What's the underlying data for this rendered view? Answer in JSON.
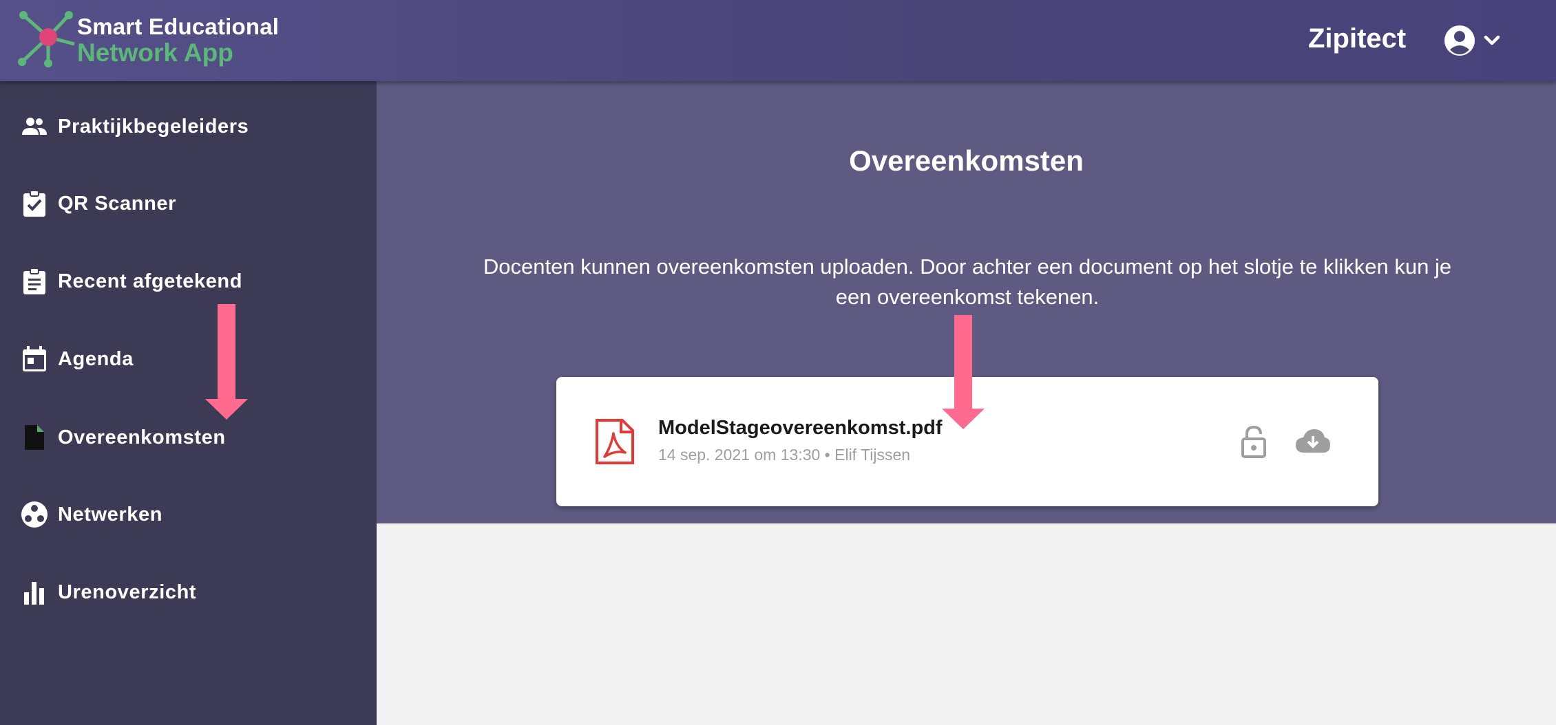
{
  "header": {
    "brand_line1": "Smart Educational",
    "brand_line2": "Network App",
    "org_name": "Zipitect",
    "account_icon": "account-circle-icon",
    "dropdown_icon": "chevron-down-icon"
  },
  "sidebar": {
    "items": [
      {
        "label": "Praktijkbegeleiders",
        "icon": "people-icon",
        "active": false
      },
      {
        "label": "QR Scanner",
        "icon": "clipboard-check-icon",
        "active": false
      },
      {
        "label": "Recent afgetekend",
        "icon": "clipboard-list-icon",
        "active": false
      },
      {
        "label": "Agenda",
        "icon": "calendar-icon",
        "active": false
      },
      {
        "label": "Overeenkomsten",
        "icon": "document-icon",
        "active": true
      },
      {
        "label": "Netwerken",
        "icon": "network-icon",
        "active": false
      },
      {
        "label": "Urenoverzicht",
        "icon": "bar-chart-icon",
        "active": false
      }
    ]
  },
  "main": {
    "title": "Overeenkomsten",
    "intro": "Docenten kunnen overeenkomsten uploaden. Door achter een document op het slotje te klikken kun je een overeenkomst tekenen.",
    "documents": [
      {
        "name": "ModelStageovereenkomst.pdf",
        "meta": "14 sep. 2021 om 13:30 • Elif Tijssen",
        "icon": "pdf-icon",
        "actions": [
          "lock-icon",
          "cloud-download-icon"
        ]
      }
    ]
  },
  "colors": {
    "header": "#4a4577",
    "sidebar": "#3d3a56",
    "active": "#55a96e",
    "hero": "#5e5a82",
    "brand_green": "#5cb878",
    "arrow": "#ff6a8e",
    "pdf_red": "#e53935"
  }
}
